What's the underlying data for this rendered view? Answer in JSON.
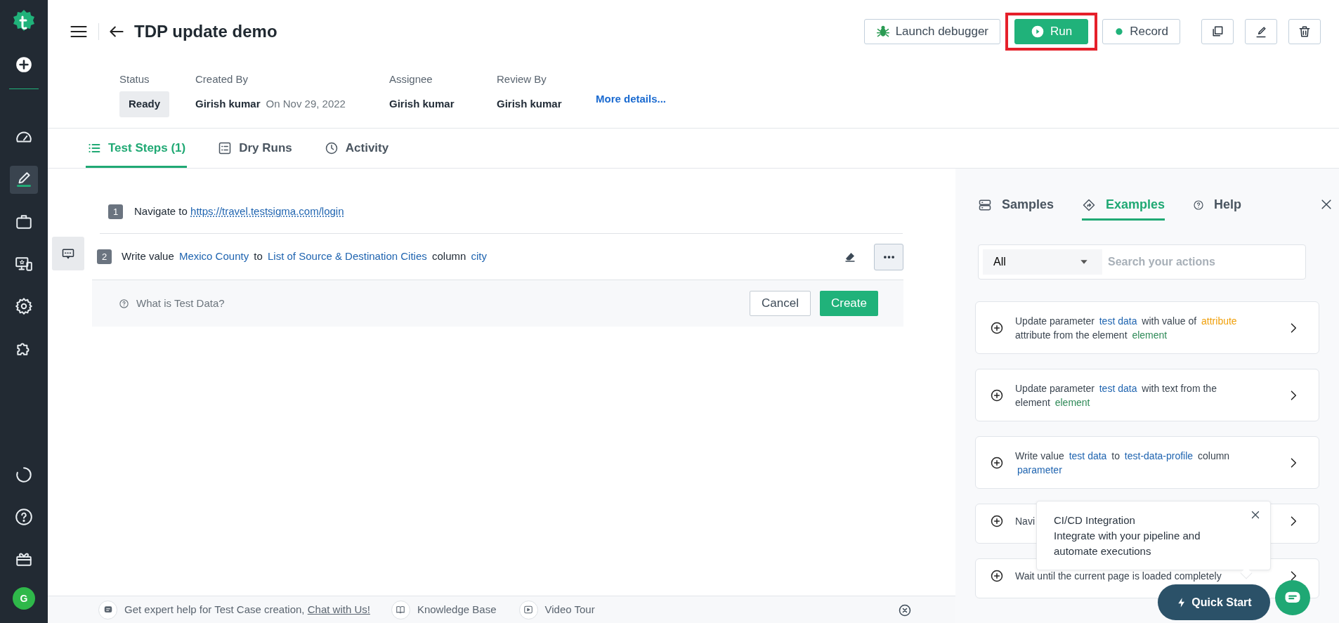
{
  "sidebar": {
    "nav": [
      {
        "selected": false
      },
      {
        "selected": true
      },
      {
        "selected": false
      },
      {
        "selected": false
      },
      {
        "selected": false
      },
      {
        "selected": false
      }
    ],
    "avatar": "G"
  },
  "header": {
    "title": "TDP update demo",
    "buttons": [
      {
        "label": "Launch debugger",
        "kind": "debug"
      },
      {
        "label": "Run",
        "kind": "run",
        "highlighted": true
      },
      {
        "label": "Record",
        "kind": "record"
      }
    ],
    "meta": [
      {
        "label": "Status",
        "value": "Ready",
        "kind": "badge"
      },
      {
        "label": "Created By",
        "value": "Girish kumar",
        "note": "On Nov 29, 2022",
        "kind": "text"
      },
      {
        "label": "Assignee",
        "value": "Girish kumar",
        "kind": "text"
      },
      {
        "label": "Review By",
        "value": "Girish kumar",
        "kind": "text"
      }
    ],
    "more_link": "More details..."
  },
  "tabs": [
    {
      "label": "Test Steps (1)",
      "selected": true
    },
    {
      "label": "Dry Runs",
      "selected": false
    },
    {
      "label": "Activity",
      "selected": false
    }
  ],
  "steps": [
    {
      "number": "1",
      "parts": [
        {
          "kind": "text",
          "text": "Navigate to"
        },
        {
          "kind": "link",
          "text": "https://travel.testsigma.com/login"
        }
      ]
    },
    {
      "number": "2",
      "parts": [
        {
          "kind": "text",
          "text": "Write value"
        },
        {
          "kind": "data",
          "text": "Mexico County"
        },
        {
          "kind": "text",
          "text": "to"
        },
        {
          "kind": "data",
          "text": "List of Source & Destination Cities"
        },
        {
          "kind": "text",
          "text": "column"
        },
        {
          "kind": "data",
          "text": "city"
        }
      ]
    }
  ],
  "editor": {
    "help": "What is Test Data?",
    "cancel": "Cancel",
    "create": "Create"
  },
  "footer": {
    "text": "Get expert help for Test Case creation,",
    "link": "Chat with Us!",
    "items": [
      "Knowledge Base",
      "Video Tour"
    ]
  },
  "panel": {
    "tabs": [
      {
        "label": "Samples",
        "selected": false
      },
      {
        "label": "Examples",
        "selected": true
      },
      {
        "label": "Help",
        "selected": false
      }
    ],
    "filter": "All",
    "search": {
      "placeholder": "Search your actions"
    },
    "cards": [
      {
        "parts": [
          {
            "kind": "text",
            "text": "Update parameter"
          },
          {
            "kind": "data",
            "text": "test data"
          },
          {
            "kind": "text",
            "text": "with value of"
          },
          {
            "kind": "attribute",
            "text": "attribute"
          },
          {
            "kind": "text",
            "text": "attribute from the element"
          },
          {
            "kind": "element",
            "text": "element"
          }
        ]
      },
      {
        "parts": [
          {
            "kind": "text",
            "text": "Update parameter"
          },
          {
            "kind": "data",
            "text": "test data"
          },
          {
            "kind": "text",
            "text": "with text from the element"
          },
          {
            "kind": "element",
            "text": "element"
          }
        ]
      },
      {
        "parts": [
          {
            "kind": "text",
            "text": "Write value"
          },
          {
            "kind": "data",
            "text": "test data"
          },
          {
            "kind": "text",
            "text": "to"
          },
          {
            "kind": "data",
            "text": "test-data-profile"
          },
          {
            "kind": "text",
            "text": "column"
          },
          {
            "kind": "data",
            "text": "parameter"
          }
        ]
      },
      {
        "parts": [
          {
            "kind": "text",
            "text": "Navi"
          }
        ]
      },
      {
        "parts": [
          {
            "kind": "text",
            "text": "Wait until the current page is loaded completely"
          }
        ]
      }
    ],
    "popover": {
      "title": "CI/CD Integration",
      "text": "Integrate with your pipeline and automate executions"
    },
    "quick_start": "Quick Start"
  }
}
